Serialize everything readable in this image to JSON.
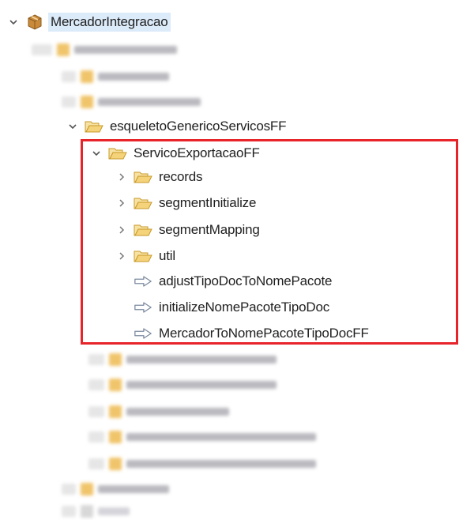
{
  "tree": {
    "root": {
      "label": "MercadorIntegracao",
      "icon": "package-icon"
    },
    "parent_folder": {
      "label": "esqueletoGenericoServicosFF",
      "icon": "folder-icon"
    },
    "selected_folder": {
      "label": "ServicoExportacaoFF",
      "icon": "folder-icon"
    },
    "children": [
      {
        "label": "records",
        "type": "folder"
      },
      {
        "label": "segmentInitialize",
        "type": "folder"
      },
      {
        "label": "segmentMapping",
        "type": "folder"
      },
      {
        "label": "util",
        "type": "folder"
      },
      {
        "label": "adjustTipoDocToNomePacote",
        "type": "service"
      },
      {
        "label": "initializeNomePacoteTipoDoc",
        "type": "service"
      },
      {
        "label": "MercadorToNomePacoteTipoDocFF",
        "type": "service"
      }
    ]
  },
  "colors": {
    "highlight_border": "#e8242b",
    "root_selection": "#dcebfa",
    "folder_fill": "#f5d37a",
    "folder_stroke": "#c79a2a"
  }
}
